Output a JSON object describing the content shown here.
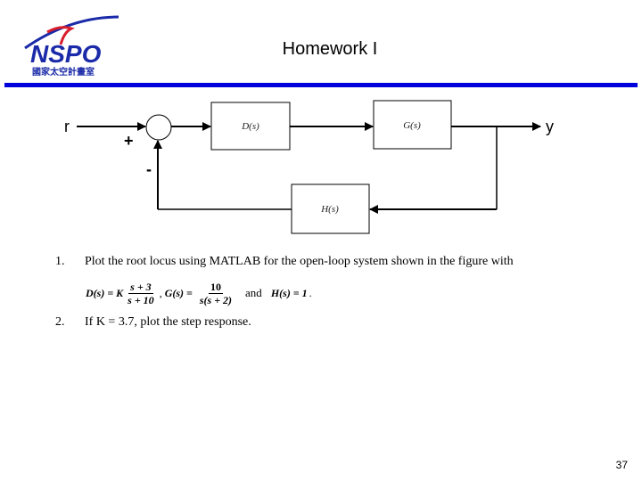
{
  "header": {
    "logo": {
      "wordmark": "NSPO",
      "subtitle": "國家太空計畫室",
      "colors": {
        "wordmark": "#1a2aa8",
        "swoosh": "#d81e2c",
        "arc": "#1a2aa8"
      }
    },
    "title": "Homework I",
    "rule_color": "#0000dd"
  },
  "diagram": {
    "input_label": "r",
    "output_label": "y",
    "plus_sign": "+",
    "minus_sign": "-",
    "blocks": [
      {
        "id": "D",
        "label": "D(s)"
      },
      {
        "id": "G",
        "label": "G(s)"
      },
      {
        "id": "H",
        "label": "H(s)"
      }
    ]
  },
  "items": [
    {
      "number": "1.",
      "text": "Plot the root locus using MATLAB  for the open-loop system shown in the figure with"
    },
    {
      "number": "2.",
      "text": "If K = 3.7, plot the step response."
    }
  ],
  "equation": {
    "d_lhs": "D(s) = K",
    "d_num": "s + 3",
    "d_den": "s + 10",
    "sep": ",",
    "g_lhs": "G(s) =",
    "g_num": "10",
    "g_den": "s(s + 2)",
    "and": "and",
    "h_expr": "H(s) = 1",
    "end": "."
  },
  "footer": {
    "page_number": "37"
  }
}
